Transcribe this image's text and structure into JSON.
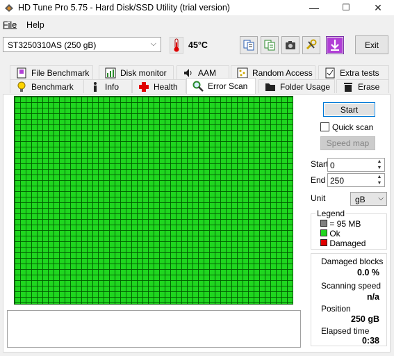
{
  "window": {
    "title": "HD Tune Pro 5.75 - Hard Disk/SSD Utility (trial version)",
    "minimize": "—",
    "maximize": "☐",
    "close": "✕"
  },
  "menu": {
    "file": "File",
    "help": "Help"
  },
  "toolbar": {
    "drive": "ST3250310AS (250 gB)",
    "temperature": "45°C",
    "exit_label": "Exit"
  },
  "tabs": {
    "row1": [
      "File Benchmark",
      "Disk monitor",
      "AAM",
      "Random Access",
      "Extra tests"
    ],
    "row2": [
      "Benchmark",
      "Info",
      "Health",
      "Error Scan",
      "Folder Usage",
      "Erase"
    ],
    "active": "Error Scan"
  },
  "scan": {
    "start_label": "Start",
    "quick_scan_label": "Quick scan",
    "quick_scan_checked": false,
    "speed_map_label": "Speed map",
    "start_field_label": "Start",
    "start_value": "0",
    "end_field_label": "End",
    "end_value": "250",
    "unit_label": "Unit",
    "unit_value": "gB"
  },
  "legend": {
    "title": "Legend",
    "items": [
      {
        "label": "= 95 MB",
        "color": "#808080"
      },
      {
        "label": "Ok",
        "color": "#1fd61f"
      },
      {
        "label": "Damaged",
        "color": "#e00000"
      }
    ]
  },
  "stats": {
    "damaged_label": "Damaged blocks",
    "damaged_value": "0.0 %",
    "speed_label": "Scanning speed",
    "speed_value": "n/a",
    "position_label": "Position",
    "position_value": "250 gB",
    "elapsed_label": "Elapsed time",
    "elapsed_value": "0:38"
  },
  "colors": {
    "ok_block": "#1fd61f",
    "accent": "#0078d7"
  }
}
